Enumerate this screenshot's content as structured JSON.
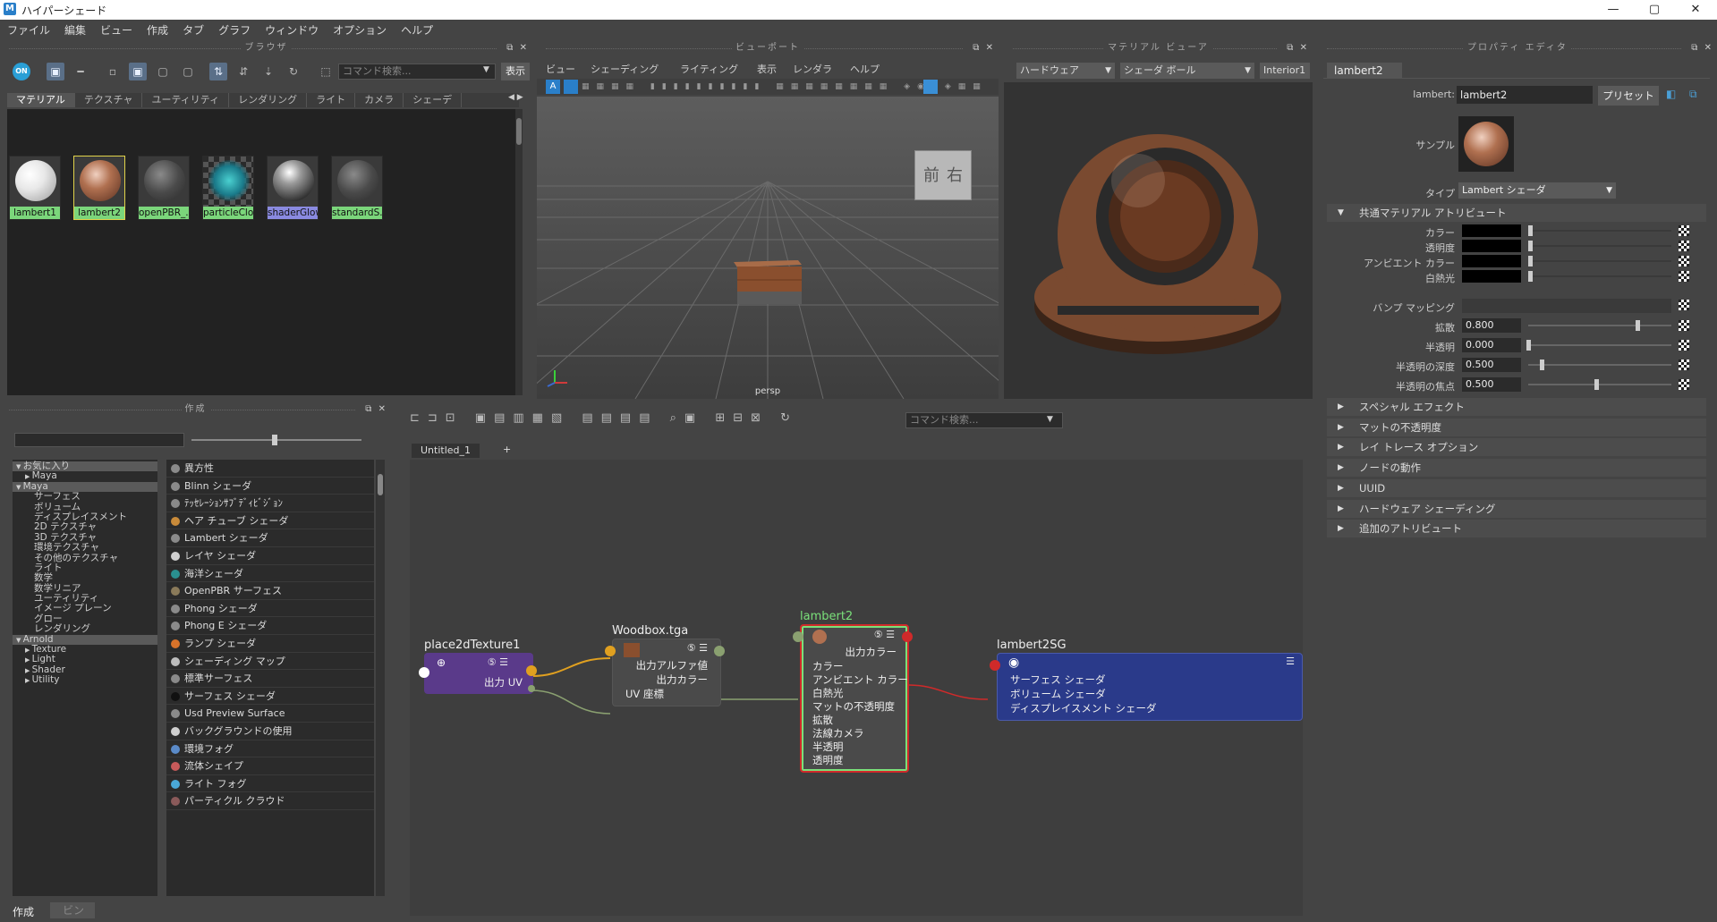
{
  "window": {
    "title": "ハイパーシェード",
    "app_icon_text": "M",
    "controls": [
      "—",
      "▢",
      "✕"
    ]
  },
  "menu": [
    "ファイル",
    "編集",
    "ビュー",
    "作成",
    "タブ",
    "グラフ",
    "ウィンドウ",
    "オプション",
    "ヘルプ"
  ],
  "browser": {
    "header": "ブラウザ",
    "toolbar_on_label": "ON",
    "search_placeholder": "コマンド検索...",
    "display_label": "表示",
    "tabs": [
      "マテリアル",
      "テクスチャ",
      "ユーティリティ",
      "レンダリング",
      "ライト",
      "カメラ",
      "シェーデ"
    ],
    "materials": [
      {
        "name": "lambert1"
      },
      {
        "name": "lambert2"
      },
      {
        "name": "openPBR_..."
      },
      {
        "name": "particleClo..."
      },
      {
        "name": "shaderGlow1"
      },
      {
        "name": "standardS..."
      }
    ]
  },
  "viewport": {
    "header": "ビューポート",
    "menu": [
      "ビュー",
      "シェーディング",
      "ライティング",
      "表示",
      "レンダラ",
      "ヘルプ"
    ],
    "camera": "persp",
    "viewcube": {
      "front": "前",
      "right": "右"
    }
  },
  "material_viewer": {
    "header": "マテリアル ビューア",
    "renderer": "ハードウェア",
    "shape": "シェーダ ボール",
    "env": "Interior1"
  },
  "create_panel": {
    "header": "作成",
    "tree": [
      {
        "label": "お気に入り",
        "indent": 0,
        "arrow": "down",
        "selected": true
      },
      {
        "label": "Maya",
        "indent": 1,
        "arrow": "right"
      },
      {
        "label": "Maya",
        "indent": 0,
        "arrow": "down",
        "selected": true
      },
      {
        "label": "サーフェス",
        "indent": 2
      },
      {
        "label": "ボリューム",
        "indent": 2
      },
      {
        "label": "ディスプレイスメント",
        "indent": 2
      },
      {
        "label": "2D テクスチャ",
        "indent": 2
      },
      {
        "label": "3D テクスチャ",
        "indent": 2
      },
      {
        "label": "環境テクスチャ",
        "indent": 2
      },
      {
        "label": "その他のテクスチャ",
        "indent": 2
      },
      {
        "label": "ライト",
        "indent": 2
      },
      {
        "label": "数学",
        "indent": 2
      },
      {
        "label": "数学リニア",
        "indent": 2
      },
      {
        "label": "ユーティリティ",
        "indent": 2
      },
      {
        "label": "イメージ プレーン",
        "indent": 2
      },
      {
        "label": "グロー",
        "indent": 2
      },
      {
        "label": "レンダリング",
        "indent": 2
      },
      {
        "label": "Arnold",
        "indent": 0,
        "arrow": "down",
        "selected": true
      },
      {
        "label": "Texture",
        "indent": 1,
        "arrow": "right"
      },
      {
        "label": "Light",
        "indent": 1,
        "arrow": "right"
      },
      {
        "label": "Shader",
        "indent": 1,
        "arrow": "right"
      },
      {
        "label": "Utility",
        "indent": 1,
        "arrow": "right"
      }
    ],
    "nodes": [
      {
        "label": "異方性",
        "color": "#8a8a8a"
      },
      {
        "label": "Blinn シェーダ",
        "color": "#8a8a8a"
      },
      {
        "label": "ﾃｯｾﾚｰｼｮﾝｻﾌﾞﾃﾞｨﾋﾞｼﾞｮﾝ",
        "color": "#8a8a8a"
      },
      {
        "label": "ヘア チューブ シェーダ",
        "color": "#c98b3a"
      },
      {
        "label": "Lambert シェーダ",
        "color": "#8a8a8a"
      },
      {
        "label": "レイヤ シェーダ",
        "color": "#cfcfcf"
      },
      {
        "label": "海洋シェーダ",
        "color": "#2a8f8f"
      },
      {
        "label": "OpenPBR サーフェス",
        "color": "#8a7a5a"
      },
      {
        "label": "Phong シェーダ",
        "color": "#8a8a8a"
      },
      {
        "label": "Phong E シェーダ",
        "color": "#8a8a8a"
      },
      {
        "label": "ランプ シェーダ",
        "color": "#d9732a"
      },
      {
        "label": "シェーディング マップ",
        "color": "#bdbdbd"
      },
      {
        "label": "標準サーフェス",
        "color": "#8a8a8a"
      },
      {
        "label": "サーフェス シェーダ",
        "color": "#111111"
      },
      {
        "label": "Usd Preview Surface",
        "color": "#8a8a8a"
      },
      {
        "label": "バックグラウンドの使用",
        "color": "#cfcfcf"
      },
      {
        "label": "環境フォグ",
        "color": "#5a8ac8"
      },
      {
        "label": "流体シェイプ",
        "color": "#c85a5a"
      },
      {
        "label": "ライト フォグ",
        "color": "#4aa8d8"
      },
      {
        "label": "パーティクル クラウド",
        "color": "#8a5a5a"
      }
    ],
    "bottom_tabs": [
      "作成",
      "ビン"
    ]
  },
  "graph": {
    "search_placeholder": "コマンド検索...",
    "tab": "Untitled_1",
    "tab_close": "✕",
    "tab_add": "+",
    "nodes": {
      "place2d": {
        "title": "place2dTexture1",
        "out": "出力 UV"
      },
      "wood": {
        "title": "Woodbox.tga",
        "rows": [
          "出力アルファ値",
          "出力カラー",
          "UV 座標"
        ]
      },
      "lambert": {
        "title": "lambert2",
        "out": "出力カラー",
        "rows": [
          "カラー",
          "アンビエント カラー",
          "白熱光",
          "マットの不透明度",
          "拡散",
          "法線カメラ",
          "半透明",
          "透明度"
        ]
      },
      "sg": {
        "title": "lambert2SG",
        "rows": [
          "サーフェス シェーダ",
          "ボリューム シェーダ",
          "ディスプレイスメント シェーダ"
        ]
      }
    }
  },
  "attribute_editor": {
    "header": "プロパティ エディタ",
    "tab": "lambert2",
    "node_type_label": "lambert:",
    "node_name": "lambert2",
    "preset_label": "プリセット",
    "sample_label": "サンプル",
    "type_label": "タイプ",
    "type_value": "Lambert シェーダ",
    "common_section": "共通マテリアル アトリビュート",
    "color_attrs": [
      "カラー",
      "透明度",
      "アンビエント カラー",
      "白熱光"
    ],
    "bump_label": "バンプ マッピング",
    "numeric_attrs": [
      {
        "label": "拡散",
        "value": "0.800",
        "level": 0.8
      },
      {
        "label": "半透明",
        "value": "0.000",
        "level": 0.0
      },
      {
        "label": "半透明の深度",
        "value": "0.500",
        "level": 0.1
      },
      {
        "label": "半透明の焦点",
        "value": "0.500",
        "level": 0.5
      }
    ],
    "sections": [
      "スペシャル エフェクト",
      "マットの不透明度",
      "レイ トレース オプション",
      "ノードの動作",
      "UUID",
      "ハードウェア シェーディング",
      "追加のアトリビュート"
    ]
  }
}
